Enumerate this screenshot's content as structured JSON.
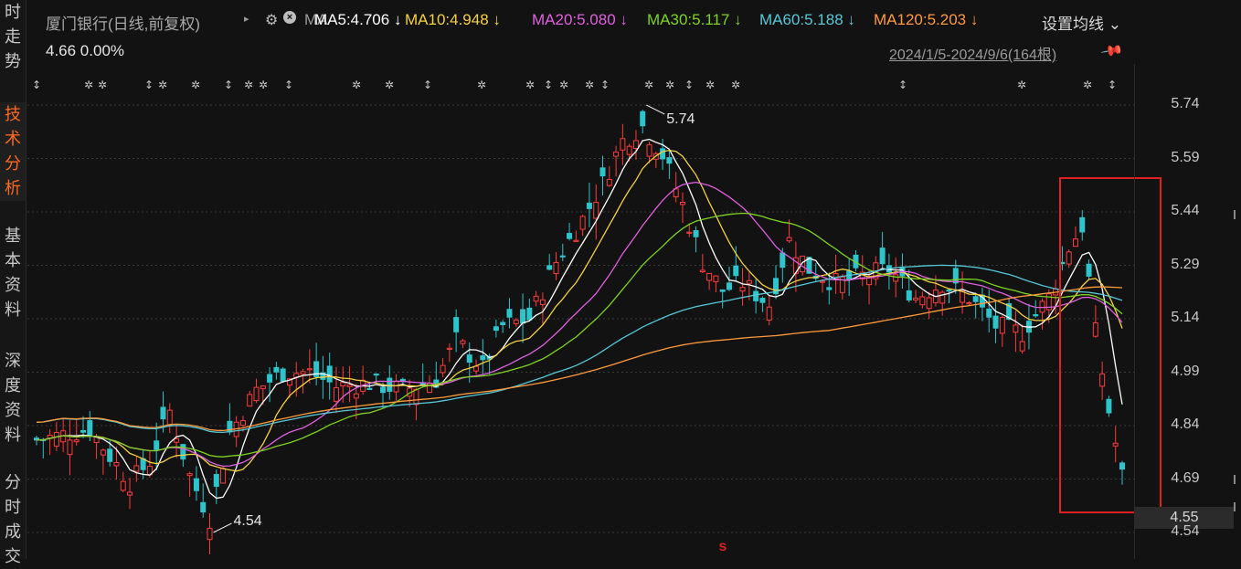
{
  "sidebar": {
    "tabs": [
      {
        "label": "时走势",
        "active": false
      },
      {
        "label": "技术分析",
        "active": true
      },
      {
        "label": "基本资料",
        "active": false
      },
      {
        "label": "深度资料",
        "active": false
      },
      {
        "label": "分时成交",
        "active": false
      }
    ]
  },
  "header": {
    "stock_title": "厦门银行(日线,前复权)",
    "ma_label": "MA",
    "ma": [
      {
        "text": "MA5:4.706 ↓",
        "color": "#ffffff"
      },
      {
        "text": "MA10:4.948 ↓",
        "color": "#f5d142"
      },
      {
        "text": "MA20:5.080 ↓",
        "color": "#e060e0"
      },
      {
        "text": "MA30:5.117 ↓",
        "color": "#7ed321"
      },
      {
        "text": "MA60:5.188 ↓",
        "color": "#56c8d8"
      },
      {
        "text": "MA120:5.203 ↓",
        "color": "#ff9a3c"
      }
    ],
    "settings_label": "设置均线",
    "settings_caret": "⌄"
  },
  "info": {
    "price_change": "4.66 0.00%",
    "date_range": "2024/1/5-2024/9/6(164根)"
  },
  "axis": {
    "ticks": [
      "5.74",
      "5.59",
      "5.44",
      "5.29",
      "5.14",
      "4.99",
      "4.84",
      "4.69",
      "4.54"
    ],
    "current_price": "4.55"
  },
  "chart_data": {
    "type": "candlestick",
    "high_label": "5.74",
    "low_label": "4.54",
    "high_value": 5.74,
    "low_value": 4.54,
    "bars": 164,
    "ylim": [
      4.52,
      5.78
    ],
    "colors": {
      "up": "#ff3b3b",
      "down": "#2ec4cc",
      "grid": "#3a3a3a",
      "highlight": "#e02020"
    },
    "ma_lines": [
      {
        "color": "#ffffff",
        "last": 4.706
      },
      {
        "color": "#f5d142",
        "last": 4.948
      },
      {
        "color": "#e060e0",
        "last": 5.08
      },
      {
        "color": "#7ed321",
        "last": 5.117
      },
      {
        "color": "#56c8d8",
        "last": 5.188
      },
      {
        "color": "#ff9a3c",
        "last": 5.203
      }
    ],
    "event_marker": "s"
  }
}
